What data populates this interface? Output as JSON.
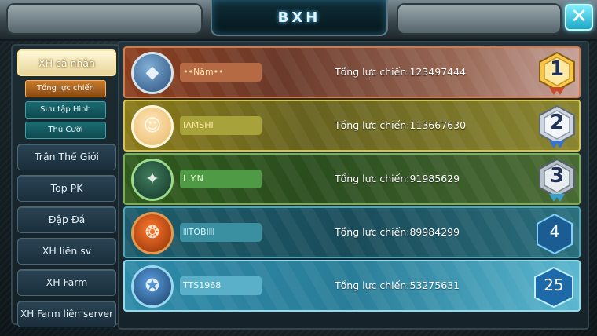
{
  "window": {
    "title": "BXH",
    "close_icon": "close-icon"
  },
  "sidebar": {
    "items": [
      {
        "label": "XH cá nhân",
        "active": true
      },
      {
        "label": "Trận Thế Giới"
      },
      {
        "label": "Top PK"
      },
      {
        "label": "Đập Đá"
      },
      {
        "label": "XH liên sv"
      },
      {
        "label": "XH Farm"
      },
      {
        "label": "XH Farm liên server"
      }
    ],
    "subitems": [
      {
        "label": "Tổng lực chiến",
        "active": true
      },
      {
        "label": "Sưu tập Hình"
      },
      {
        "label": "Thú Cưỡi"
      }
    ]
  },
  "ranking": [
    {
      "rank": "1",
      "name": "••Năm••",
      "power": "Tổng lực chiến:123497444",
      "badge": "gold-medal-icon"
    },
    {
      "rank": "2",
      "name": "IAMSHI",
      "power": "Tổng lực chiến:113667630",
      "badge": "silver-medal-icon"
    },
    {
      "rank": "3",
      "name": "L.Y.N",
      "power": "Tổng lực chiến:91985629",
      "badge": "bronze-medal-icon"
    },
    {
      "rank": "4",
      "name": "ꔖTOBIꔖ",
      "power": "Tổng lực chiến:89984299",
      "badge": "hexagon-rank-icon"
    },
    {
      "rank": "25",
      "name": "TTS1968",
      "power": "Tổng lực chiến:53275631",
      "badge": "hexagon-rank-icon"
    }
  ],
  "colors": {
    "accent": "#4fc4ff",
    "gold": "#f5c84a",
    "silver": "#cfd6e0"
  }
}
